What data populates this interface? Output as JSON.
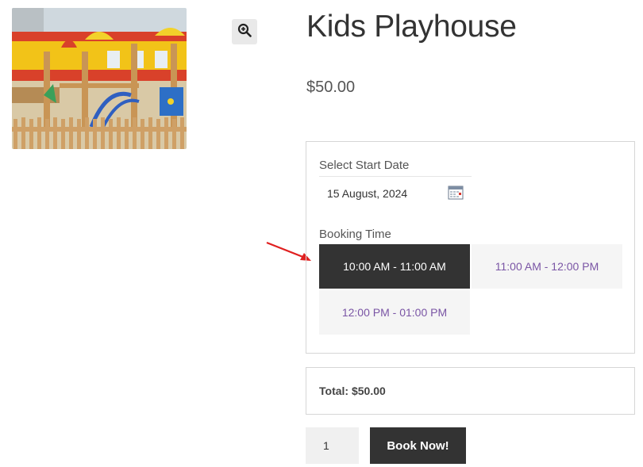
{
  "product": {
    "title": "Kids Playhouse",
    "price": "$50.00"
  },
  "icons": {
    "zoom": "magnifier-plus-icon",
    "calendar": "calendar-icon",
    "annotation": "red-arrow-icon"
  },
  "booking": {
    "start_date_label": "Select Start Date",
    "start_date_value": "15 August, 2024",
    "time_label": "Booking Time",
    "slots": [
      {
        "label": "10:00 AM - 11:00 AM",
        "selected": true
      },
      {
        "label": "11:00 AM - 12:00 PM",
        "selected": false
      },
      {
        "label": "12:00 PM - 01:00 PM",
        "selected": false
      }
    ]
  },
  "total": {
    "label": "Total: $50.00"
  },
  "cart": {
    "quantity": "1",
    "book_label": "Book Now!"
  },
  "colors": {
    "selected_slot_bg": "#333333",
    "available_slot_text": "#7a55a5",
    "annotation_arrow": "#e02020"
  }
}
